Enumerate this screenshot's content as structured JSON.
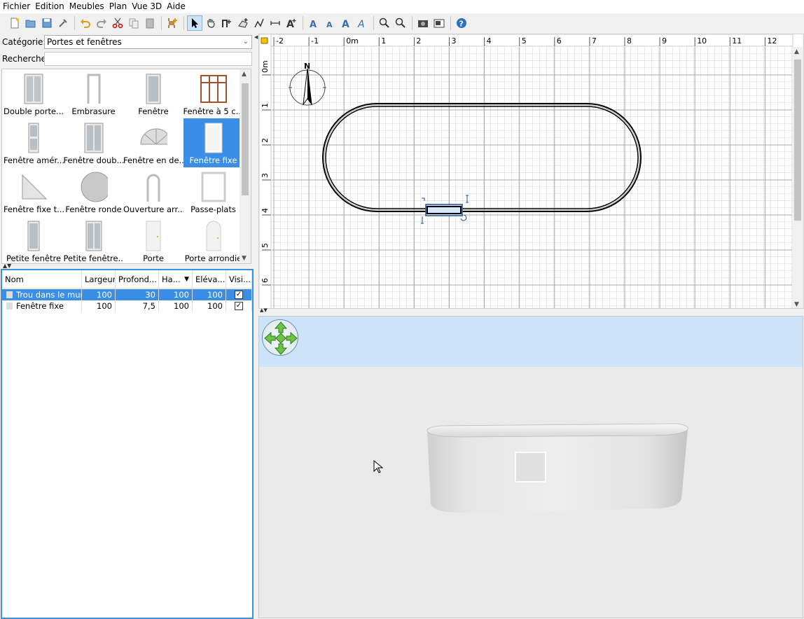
{
  "menu": [
    "Fichier",
    "Edition",
    "Meubles",
    "Plan",
    "Vue 3D",
    "Aide"
  ],
  "toolbar": {
    "icons": [
      "new-home-icon",
      "open-icon",
      "save-icon",
      "preferences-icon",
      "undo-icon",
      "redo-icon",
      "cut-icon",
      "copy-icon",
      "paste-icon",
      "add-furniture-icon",
      "select-mode-icon",
      "pan-mode-icon",
      "create-walls-icon",
      "create-rooms-icon",
      "create-polylines-icon",
      "create-dimensions-icon",
      "add-text-icon",
      "increase-text-icon",
      "decrease-text-icon",
      "bold-text-icon",
      "italic-text-icon",
      "zoom-in-icon",
      "zoom-out-icon",
      "photo-icon",
      "video-icon",
      "help-icon"
    ]
  },
  "catalog": {
    "category_label": "Catégorie:",
    "category_value": "Portes et fenêtres",
    "search_label": "Recherche:",
    "search_value": "",
    "items": [
      {
        "label": "Double porte...",
        "icon": "double-door-icon"
      },
      {
        "label": "Embrasure",
        "icon": "doorframe-icon"
      },
      {
        "label": "Fenêtre",
        "icon": "window-icon"
      },
      {
        "label": "Fenêtre à 5 c...",
        "icon": "window-5-panes-icon"
      },
      {
        "label": "Fenêtre amér...",
        "icon": "american-window-icon"
      },
      {
        "label": "Fenêtre doub...",
        "icon": "double-window-icon"
      },
      {
        "label": "Fenêtre en de...",
        "icon": "half-round-window-icon"
      },
      {
        "label": "Fenêtre fixe",
        "icon": "fixed-window-icon",
        "selected": true
      },
      {
        "label": "Fenêtre fixe t...",
        "icon": "triangle-window-icon"
      },
      {
        "label": "Fenêtre ronde",
        "icon": "round-window-icon"
      },
      {
        "label": "Ouverture arr...",
        "icon": "arched-opening-icon"
      },
      {
        "label": "Passe-plats",
        "icon": "service-hatch-icon"
      },
      {
        "label": "Petite fenêtre",
        "icon": "small-window-icon"
      },
      {
        "label": "Petite fenêtre...",
        "icon": "small-double-window-icon"
      },
      {
        "label": "Porte",
        "icon": "door-icon"
      },
      {
        "label": "Porte arrondie",
        "icon": "round-door-icon"
      }
    ]
  },
  "furniture_list": {
    "columns": [
      "Nom",
      "Largeur",
      "Profond...",
      "Ha...",
      "Eléva...",
      "Visi..."
    ],
    "sort_indicator": "▼",
    "rows": [
      {
        "name": "Trou dans le mur",
        "width": "100",
        "depth": "30",
        "height": "100",
        "elevation": "100",
        "visible": true,
        "selected": true
      },
      {
        "name": "Fenêtre fixe",
        "width": "100",
        "depth": "7,5",
        "height": "100",
        "elevation": "100",
        "visible": true,
        "selected": false
      }
    ]
  },
  "plan": {
    "x_ticks": [
      "-2",
      "-1",
      "0m",
      "1",
      "2",
      "3",
      "4",
      "5",
      "6",
      "7",
      "8",
      "9",
      "10",
      "11",
      "12"
    ],
    "y_ticks": [
      "0m",
      "1",
      "2",
      "3",
      "4",
      "5",
      "6"
    ],
    "compass_label": "N"
  },
  "view3d": {
    "sky_color": "#cde3f8",
    "ground_color": "#eaeaea"
  }
}
